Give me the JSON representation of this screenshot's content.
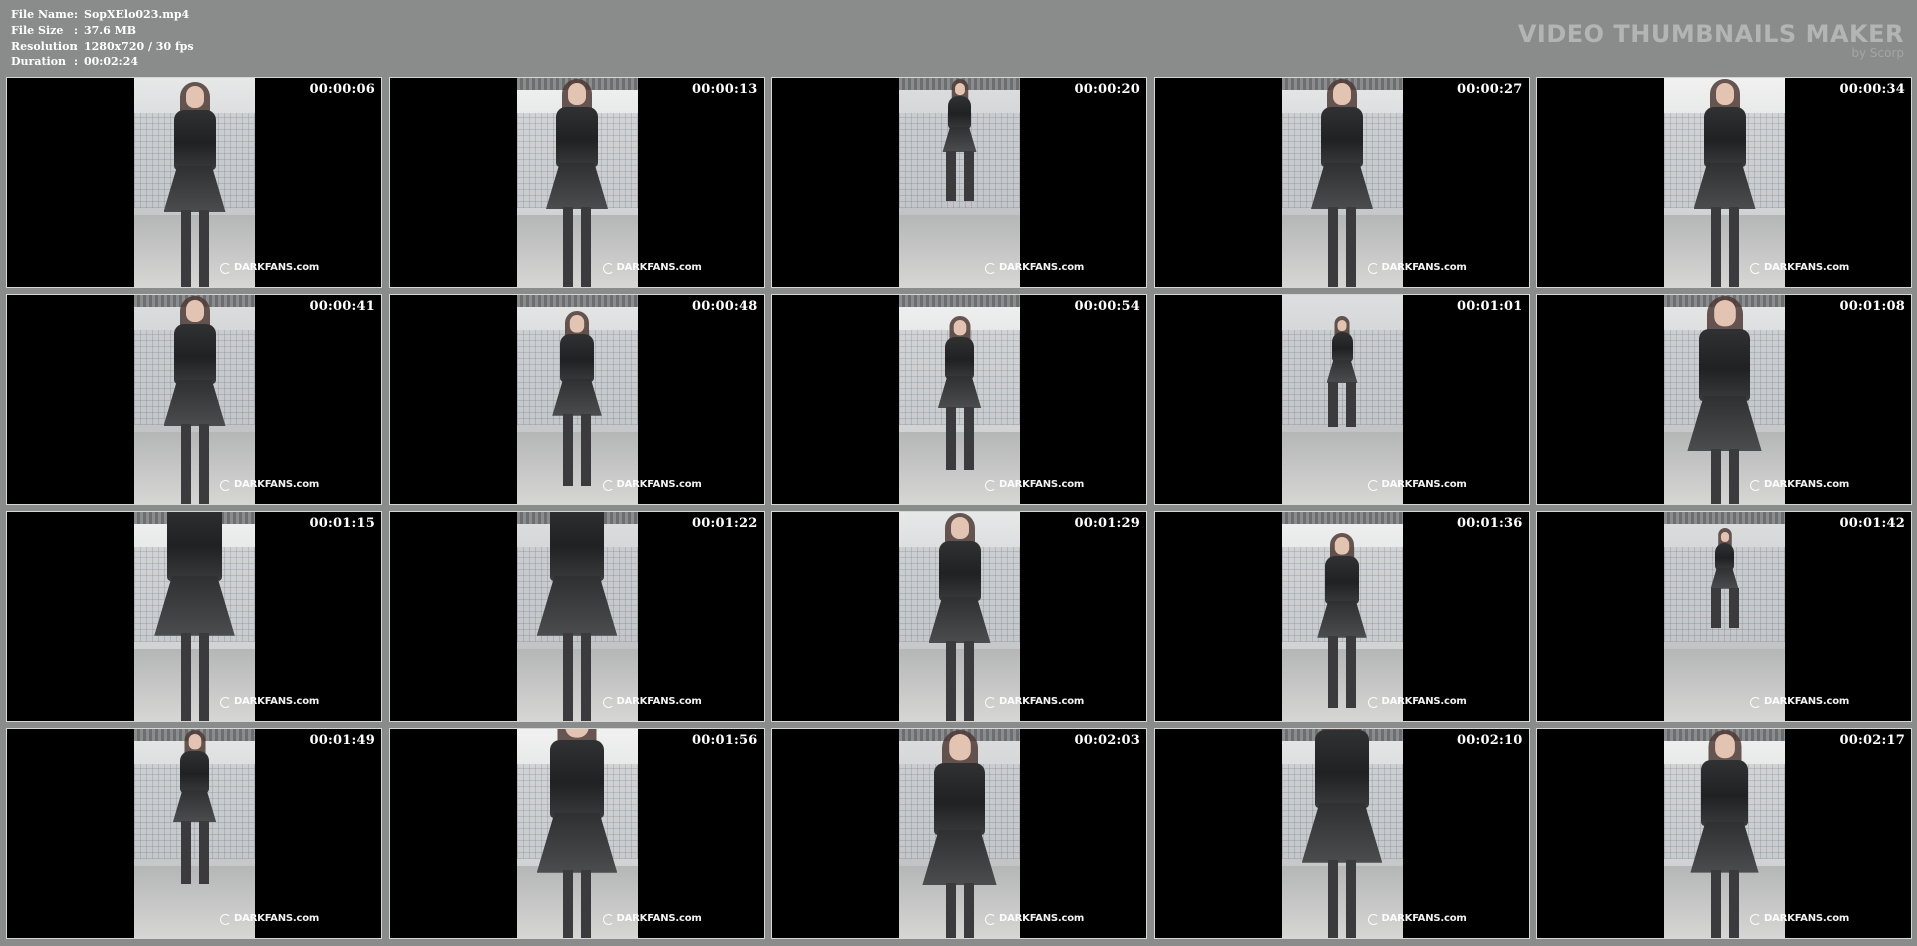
{
  "header": {
    "info": [
      {
        "label": "File Name",
        "sep": ":",
        "value": "SopXElo023.mp4"
      },
      {
        "label": "File Size",
        "sep": ":",
        "value": "37.6 MB"
      },
      {
        "label": "Resolution",
        "sep": ":",
        "value": "1280x720 / 30 fps"
      },
      {
        "label": "Duration",
        "sep": ":",
        "value": "00:02:24"
      }
    ],
    "brand": {
      "title": "VIDEO THUMBNAILS MAKER",
      "subtitle": "by Scorp"
    }
  },
  "watermark": {
    "icon": "darkfans-logo-icon",
    "text": "DARKFANS.com"
  },
  "thumbnails": [
    {
      "time": "00:00:06"
    },
    {
      "time": "00:00:13"
    },
    {
      "time": "00:00:20"
    },
    {
      "time": "00:00:27"
    },
    {
      "time": "00:00:34"
    },
    {
      "time": "00:00:41"
    },
    {
      "time": "00:00:48"
    },
    {
      "time": "00:00:54"
    },
    {
      "time": "00:01:01"
    },
    {
      "time": "00:01:08"
    },
    {
      "time": "00:01:15"
    },
    {
      "time": "00:01:22"
    },
    {
      "time": "00:01:29"
    },
    {
      "time": "00:01:36"
    },
    {
      "time": "00:01:42"
    },
    {
      "time": "00:01:49"
    },
    {
      "time": "00:01:56"
    },
    {
      "time": "00:02:03"
    },
    {
      "time": "00:02:10"
    },
    {
      "time": "00:02:17"
    }
  ],
  "colors": {
    "background": "#8a8c8b",
    "thumbnail_border": "#d5d6d5",
    "text": "#ffffff",
    "brand": "#b3b4b3"
  }
}
